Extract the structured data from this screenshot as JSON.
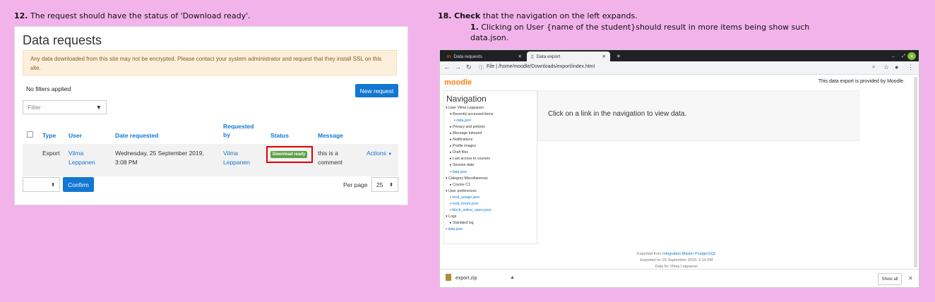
{
  "step12": {
    "num": "12.",
    "text": " The request should have the status of 'Download ready'."
  },
  "step18": {
    "num": "18.",
    "bold": "Check",
    "text": " that the navigation on the left expands.",
    "sub_num": "1.",
    "sub_text": " Clicking on User {name of the student}should result in more items being show such",
    "sub_text2": "data.json."
  },
  "left": {
    "title": "Data requests",
    "alert": "Any data downloaded from this site may not be encrypted. Please contact your system administrator and request that they install SSL on this site.",
    "no_filters": "No filters applied",
    "new_request": "New request",
    "filter_placeholder": "Filter",
    "headers": {
      "type": "Type",
      "user": "User",
      "date": "Date requested",
      "requested_by_1": "Requested",
      "requested_by_2": "by",
      "status": "Status",
      "message": "Message"
    },
    "row": {
      "type": "Export",
      "user_1": "Vilma",
      "user_2": "Leppanen",
      "date_1": "Wednesday, 25 September 2019,",
      "date_2": "3:08 PM",
      "req_1": "Vilma",
      "req_2": "Leppanen",
      "status": "Download ready",
      "msg_1": "this is a",
      "msg_2": "comment",
      "actions": "Actions"
    },
    "confirm": "Confirm",
    "per_page_label": "Per page",
    "per_page_value": "25"
  },
  "browser": {
    "tab1": "Data requests",
    "tab2": "Data export",
    "url": "File  |  /home/moodle/Downloads/export/index.html",
    "logo": "moodle",
    "provided": "This data export is provided by Moodle.",
    "nav_title": "Navigation",
    "nav_items": [
      {
        "label": "User Vilma Leppanen",
        "indent": 0,
        "arrow": "down",
        "link": false
      },
      {
        "label": "Recently accessed items",
        "indent": 1,
        "arrow": "down",
        "link": false
      },
      {
        "label": "data.json",
        "indent": 2,
        "arrow": "dot",
        "link": true
      },
      {
        "label": "Privacy and policies",
        "indent": 1,
        "arrow": "right",
        "link": false
      },
      {
        "label": "Message Inbound",
        "indent": 1,
        "arrow": "right",
        "link": false
      },
      {
        "label": "Notifications",
        "indent": 1,
        "arrow": "right",
        "link": false
      },
      {
        "label": "Profile images",
        "indent": 1,
        "arrow": "right",
        "link": false
      },
      {
        "label": "Draft files",
        "indent": 1,
        "arrow": "right",
        "link": false
      },
      {
        "label": "Last access to courses",
        "indent": 1,
        "arrow": "right",
        "link": false
      },
      {
        "label": "Session data",
        "indent": 1,
        "arrow": "right",
        "link": false
      },
      {
        "label": "data.json",
        "indent": 1,
        "arrow": "dot",
        "link": true
      },
      {
        "label": "Category Miscellaneous",
        "indent": 0,
        "arrow": "down",
        "link": false
      },
      {
        "label": "Course C1",
        "indent": 1,
        "arrow": "right",
        "link": false
      },
      {
        "label": "User preferences",
        "indent": 0,
        "arrow": "down",
        "link": false
      },
      {
        "label": "mod_assign.json",
        "indent": 1,
        "arrow": "dot",
        "link": true
      },
      {
        "label": "mod_forum.json",
        "indent": 1,
        "arrow": "dot",
        "link": true
      },
      {
        "label": "block_online_users.json",
        "indent": 1,
        "arrow": "dot",
        "link": true
      },
      {
        "label": "Logs",
        "indent": 0,
        "arrow": "down",
        "link": false
      },
      {
        "label": "Standard log",
        "indent": 1,
        "arrow": "right",
        "link": false
      },
      {
        "label": "data.json",
        "indent": 0,
        "arrow": "dot",
        "link": true
      }
    ],
    "main_msg": "Click on a link in the navigation to view data.",
    "footer1_prefix": "Exported from ",
    "footer1_link": "Integration Master PostgreSQL",
    "footer2": "Exported on 25 September 2019, 3:10 PM",
    "footer3": "Data for Vilma Leppanen",
    "download_file": "export.zip",
    "show_all": "Show all"
  }
}
